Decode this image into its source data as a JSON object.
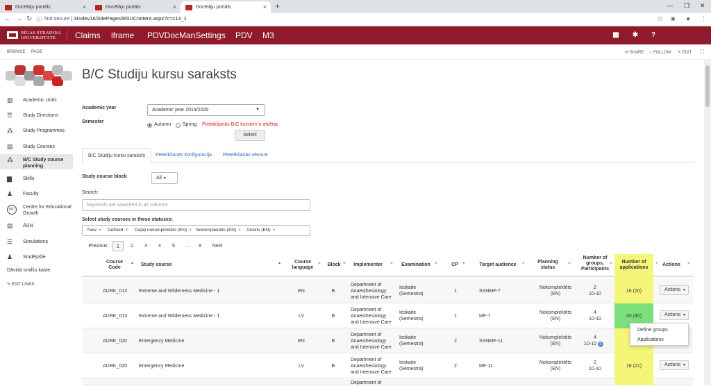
{
  "browser": {
    "tabs": [
      {
        "label": "Docētāju portāls"
      },
      {
        "label": "Docētāju portāls"
      },
      {
        "label": "Docētāju portāls"
      }
    ],
    "url_prefix": "Not secure",
    "url": "3rodev16/SitePages/RSUContent.aspx?c=c13_1"
  },
  "topbar": {
    "logo_line1": "RĪGAS STRADIŅA",
    "logo_line2": "UNIVERSITĀTE",
    "nav": [
      "Claims",
      "iframe",
      "PDVDocManSettings",
      "PDV",
      "M3"
    ],
    "help": "?"
  },
  "ribbon": {
    "browse": "BROWSE",
    "page": "PAGE",
    "share": "SHARE",
    "follow": "FOLLOW",
    "edit": "EDIT"
  },
  "sidebar": {
    "items": [
      {
        "label": "Academic Units",
        "icon": "building-icon"
      },
      {
        "label": "Study Directions",
        "icon": "signpost-icon"
      },
      {
        "label": "Study Programmes",
        "icon": "network-icon"
      },
      {
        "label": "Study Courses",
        "icon": "books-icon"
      },
      {
        "label": "B/C Study course planning",
        "icon": "network-icon"
      },
      {
        "label": "Skills",
        "icon": "chart-icon"
      },
      {
        "label": "Faculty",
        "icon": "person-icon"
      },
      {
        "label": "Centre for Educational Growth",
        "icon": "pic-logo-icon"
      },
      {
        "label": "ĀSN",
        "icon": "books-icon"
      },
      {
        "label": "Simulations",
        "icon": "signpost-icon"
      },
      {
        "label": "Studējošie",
        "icon": "person-icon"
      }
    ],
    "extra": "Dāvida smilšu kaste",
    "edit_links": "EDIT LINKS"
  },
  "page": {
    "title": "B/C Studiju kursu saraksts",
    "academic_year_label": "Academic year",
    "academic_year_value": "Academic year 2019/2020",
    "semester_label": "Semester",
    "autumn": "Autumn",
    "spring": "Spring",
    "notice": "Pieteikšanās B/C kursiem ir atvērta",
    "select_button": "Select",
    "tabs": [
      "B/C Studiju kursu saraksts",
      "Pieteikšanās konfigurācija",
      "Pieteikšanās vēsture"
    ],
    "block_label": "Study course block",
    "block_value": "All",
    "search_label": "Search:",
    "search_placeholder": "keywords are searched in all columns",
    "status_label": "Select study courses in these statuses:",
    "statuses": [
      "New",
      "Defined",
      "Daļēji nokomplektēts (EN)",
      "Nokomplektēts (EN)",
      "Atcelts (EN)"
    ],
    "pager": {
      "previous": "Previous",
      "pages": [
        "1",
        "2",
        "3",
        "4",
        "5",
        "…",
        "8"
      ],
      "next": "Next"
    }
  },
  "table": {
    "headers": {
      "code": "Course Code",
      "course": "Study course",
      "language": "Course language",
      "block": "Block",
      "implementer": "Implementer",
      "examination": "Examination",
      "cp": "CP",
      "audience": "Target audience",
      "planning": "Planning status",
      "groups": "Number of groups, Participants",
      "applications": "Number of applications",
      "actions": "Actions"
    },
    "rows": [
      {
        "code": "AURK_013",
        "course": "Extreme and Wilderness Medicine - 1",
        "language": "EN",
        "block": "B",
        "implementer": "Department of Anaesthesiology and Intensive Care",
        "examination": "Ieskaite (Semestra)",
        "cp": "1",
        "audience": "SSNMF-7",
        "planning": "Nokomplektēts (EN)",
        "groups": "2",
        "participants": "10-10",
        "applications": "16 (20)",
        "app_color": "yellow",
        "action": "Actions"
      },
      {
        "code": "AURK_013",
        "course": "Extreme and Wilderness Medicine - 1",
        "language": "LV",
        "block": "B",
        "implementer": "Department of Anaesthesiology and Intensive Care",
        "examination": "Ieskaite (Semestra)",
        "cp": "1",
        "audience": "MF-7",
        "planning": "Nokomplektēts (EN)",
        "groups": "4",
        "participants": "10-10",
        "applications": "40 (40)",
        "app_color": "green",
        "action": "Actions"
      },
      {
        "code": "AURK_020",
        "course": "Emergency Medicine",
        "language": "EN",
        "block": "B",
        "implementer": "Department of Anaesthesiology and Intensive Care",
        "examination": "Ieskaite (Semestra)",
        "cp": "2",
        "audience": "SSNMF-11",
        "planning": "Nokomplektēts (EN)",
        "groups": "4",
        "participants": "10-10",
        "applications": "",
        "app_color": "yellow",
        "action": ""
      },
      {
        "code": "AURK_020",
        "course": "Emergency Medicine",
        "language": "LV",
        "block": "B",
        "implementer": "Department of Anaesthesiology and Intensive Care",
        "examination": "Ieskaite (Semestra)",
        "cp": "2",
        "audience": "MF-11",
        "planning": "Nokomplektēts (EN)",
        "groups": "2",
        "participants": "10-10",
        "applications": "18 (21)",
        "app_color": "yellow",
        "action": "Actions"
      }
    ],
    "last_row_partial": "Department of"
  },
  "actions_menu": {
    "items": [
      "Define groups",
      "Applications"
    ]
  },
  "colors": {
    "brand": "#8e1a2c",
    "link": "#2a6ebb",
    "notice": "#e21b1b",
    "yellow": "#f5f57a",
    "green": "#7be07b"
  }
}
